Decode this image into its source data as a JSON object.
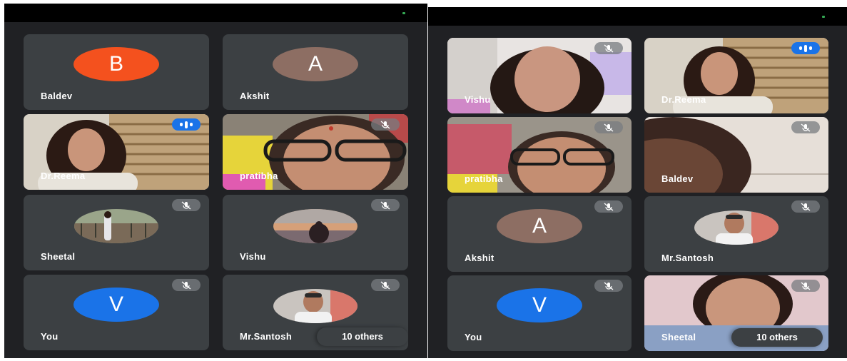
{
  "colors": {
    "background": "#202124",
    "tile": "#3c4043",
    "avatar_orange": "#f4511e",
    "avatar_brown": "#8d6e63",
    "avatar_blue": "#1a73e8",
    "speaking_blue": "#1a73e8"
  },
  "left_screen": {
    "tiles": [
      {
        "name": "Baldev",
        "avatar": "B",
        "type": "letter"
      },
      {
        "name": "Akshit",
        "avatar": "A",
        "type": "letter"
      },
      {
        "name": "Dr.Reema",
        "type": "video",
        "status": "speaking"
      },
      {
        "name": "pratibha",
        "type": "video",
        "status": "muted"
      },
      {
        "name": "Sheetal",
        "type": "photo",
        "status": "muted"
      },
      {
        "name": "Vishu",
        "type": "photo",
        "status": "muted"
      },
      {
        "name": "You",
        "avatar": "V",
        "type": "letter",
        "status": "muted"
      },
      {
        "name": "Mr.Santosh",
        "type": "photo",
        "status": "muted"
      }
    ],
    "others_label": "10 others"
  },
  "right_screen": {
    "tiles": [
      {
        "name": "Vishu",
        "type": "video",
        "status": "muted"
      },
      {
        "name": "Dr.Reema",
        "type": "video",
        "status": "speaking"
      },
      {
        "name": "pratibha",
        "type": "video",
        "status": "muted"
      },
      {
        "name": "Baldev",
        "type": "video",
        "status": "muted"
      },
      {
        "name": "Akshit",
        "avatar": "A",
        "type": "letter",
        "status": "muted"
      },
      {
        "name": "Mr.Santosh",
        "type": "photo",
        "status": "muted"
      },
      {
        "name": "You",
        "avatar": "V",
        "type": "letter",
        "status": "muted"
      },
      {
        "name": "Sheetal",
        "type": "video",
        "status": "muted"
      }
    ],
    "others_label": "10 others"
  },
  "icons": {
    "muted": "mic-off-icon",
    "speaking": "audio-level-icon"
  }
}
